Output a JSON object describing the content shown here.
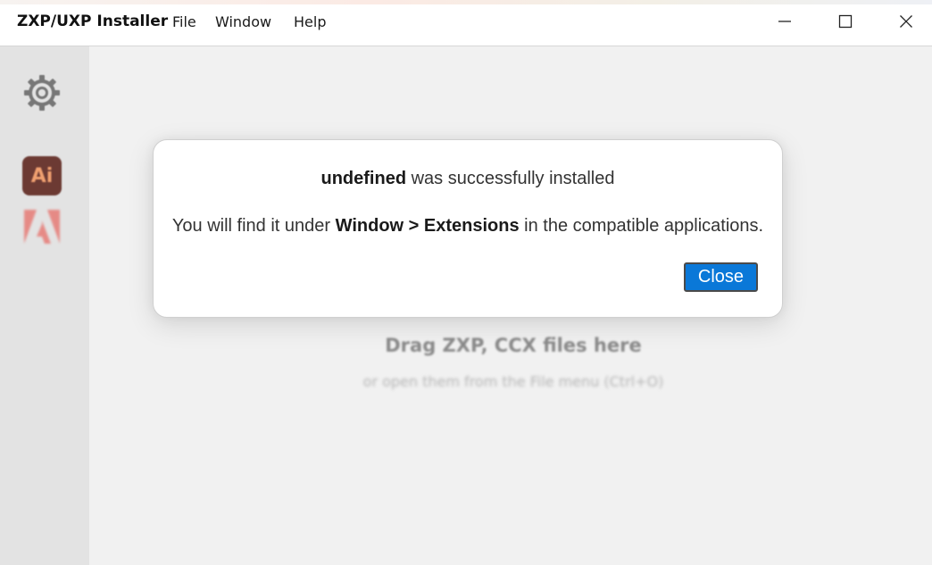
{
  "window": {
    "title": "ZXP/UXP Installer",
    "menu": [
      "File",
      "Window",
      "Help"
    ]
  },
  "sidebar": {
    "items": [
      {
        "name": "settings",
        "icon": "gear-icon"
      },
      {
        "name": "illustrator",
        "icon": "illustrator-icon",
        "label": "Ai"
      },
      {
        "name": "adobe",
        "icon": "adobe-logo-icon"
      }
    ]
  },
  "main": {
    "drop_title": "Drag ZXP, CCX files here",
    "drop_subtitle": "or open them from the File menu (Ctrl+O)"
  },
  "dialog": {
    "line1_bold": "undefined",
    "line1_rest": " was successfully installed",
    "line2_prefix": "You will find it under ",
    "line2_bold": "Window > Extensions",
    "line2_suffix": " in the compatible applications.",
    "close_label": "Close"
  },
  "colors": {
    "accent": "#0a78d8",
    "sidebar_bg": "#e3e3e3",
    "content_bg": "#f1f1f1",
    "illustrator_bg": "#6c3a33",
    "adobe_red": "#e8423a"
  }
}
